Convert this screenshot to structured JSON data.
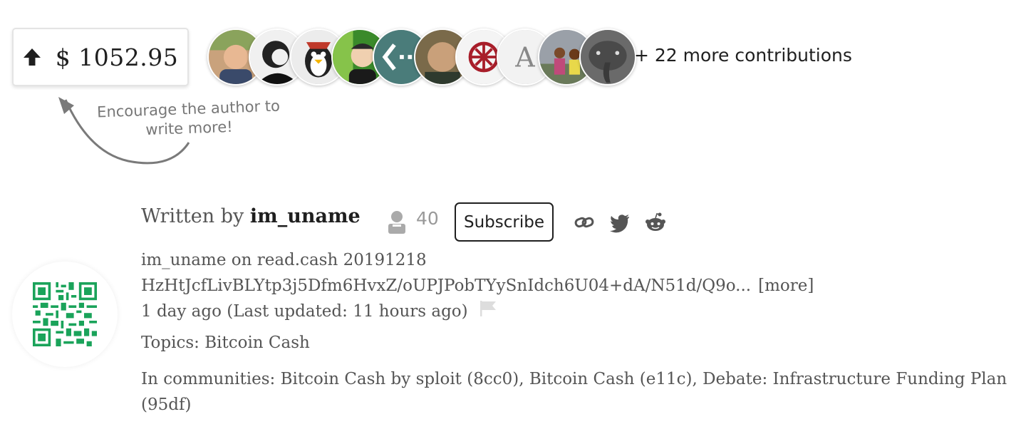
{
  "tip": {
    "amount": "$ 1052.95",
    "icon": "up-arrow-icon"
  },
  "contributors": {
    "avatars": [
      {
        "name": "avatar-1",
        "bg": "#c9a27c"
      },
      {
        "name": "avatar-2",
        "bg": "#f0f0f0"
      },
      {
        "name": "avatar-3",
        "bg": "#ececec"
      },
      {
        "name": "avatar-4",
        "bg": "#3a8a2a"
      },
      {
        "name": "avatar-5",
        "bg": "#4a7c7a"
      },
      {
        "name": "avatar-6",
        "bg": "#7a6a4a"
      },
      {
        "name": "avatar-7",
        "bg": "#f4f4f4"
      },
      {
        "name": "avatar-8",
        "bg": "#f2f2f2",
        "letter": "A"
      },
      {
        "name": "avatar-9",
        "bg": "#9aa0a8"
      },
      {
        "name": "avatar-10",
        "bg": "#6a6a6a"
      }
    ],
    "more_text": "+ 22 more contributions"
  },
  "encourage": {
    "line1": "Encourage the author to",
    "line2": "write more!"
  },
  "author": {
    "written_by": "Written by",
    "username": "im_uname",
    "follower_count": "40",
    "subscribe_label": "Subscribe"
  },
  "share": [
    "link-icon",
    "twitter-icon",
    "reddit-icon"
  ],
  "meta": {
    "signature_line1": "im_uname on read.cash 20191218",
    "signature_line2": "HzHtJcfLivBLYtp3j5Dfm6HvxZ/oUPJPobTYySnIdch6U04+dA/N51d/Q9o...",
    "more_label": "[more]",
    "time": "1 day ago (Last updated: 11 hours ago)",
    "topics": "Topics: Bitcoin Cash",
    "communities": "In communities: Bitcoin Cash by sploit (8cc0), Bitcoin Cash (e11c), Debate: Infrastructure Funding Plan (95df)"
  },
  "colors": {
    "accent": "#1f1f1f",
    "muted": "#555555",
    "qr": "#1aa35a"
  }
}
